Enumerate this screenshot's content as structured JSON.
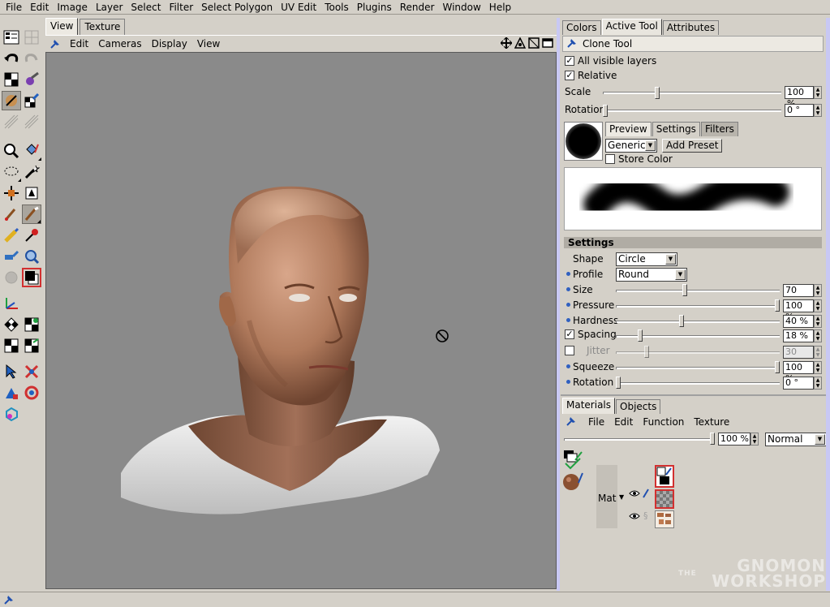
{
  "menubar": [
    "File",
    "Edit",
    "Image",
    "Layer",
    "Select",
    "Filter",
    "Select Polygon",
    "UV Edit",
    "Tools",
    "Plugins",
    "Render",
    "Window",
    "Help"
  ],
  "view_tabs": {
    "view": "View",
    "texture": "Texture"
  },
  "view_menu": {
    "edit": "Edit",
    "cameras": "Cameras",
    "display": "Display",
    "view": "View"
  },
  "right_tabs": {
    "colors": "Colors",
    "active_tool": "Active Tool",
    "attributes": "Attributes"
  },
  "tool": {
    "name": "Clone Tool",
    "all_visible_layers": "All visible layers",
    "relative": "Relative",
    "scale_label": "Scale",
    "scale_value": "100 %",
    "rotation_label": "Rotation",
    "rotation_value": "0 °"
  },
  "brush_tabs": {
    "preview": "Preview",
    "settings": "Settings",
    "filters": "Filters"
  },
  "brush": {
    "preset": "Generic",
    "add_preset": "Add Preset",
    "store_color": "Store Color"
  },
  "settings": {
    "header": "Settings",
    "shape_label": "Shape",
    "shape_value": "Circle",
    "profile_label": "Profile",
    "profile_value": "Round",
    "size_label": "Size",
    "size_value": "70",
    "size_level": 0.42,
    "pressure_label": "Pressure",
    "pressure_value": "100 %",
    "pressure_level": 1.0,
    "hardness_label": "Hardness",
    "hardness_value": "40 %",
    "hardness_level": 0.4,
    "spacing_label": "Spacing",
    "spacing_value": "18 %",
    "spacing_level": 0.14,
    "jitter_label": "Jitter",
    "jitter_value": "30",
    "jitter_level": 0.18,
    "squeeze_label": "Squeeze",
    "squeeze_value": "100 %",
    "squeeze_level": 1.0,
    "rotation_label": "Rotation",
    "rotation_value": "0 °",
    "rotation_level": 0.0
  },
  "tool_slider_levels": {
    "scale": 0.3,
    "rotation": 0.0
  },
  "materials": {
    "tabs": {
      "materials": "Materials",
      "objects": "Objects"
    },
    "menu": {
      "file": "File",
      "edit": "Edit",
      "function": "Function",
      "texture": "Texture"
    },
    "opacity_value": "100 %",
    "blend_mode": "Normal",
    "material_name": "Mat"
  },
  "watermark": {
    "the": "THE",
    "line1": "GNOMON",
    "line2": "WORKSHOP"
  },
  "colors": {
    "accent_edge": "#c8c8f4",
    "viewport_bg": "#8a8a8a",
    "selection_red": "#d23030"
  }
}
